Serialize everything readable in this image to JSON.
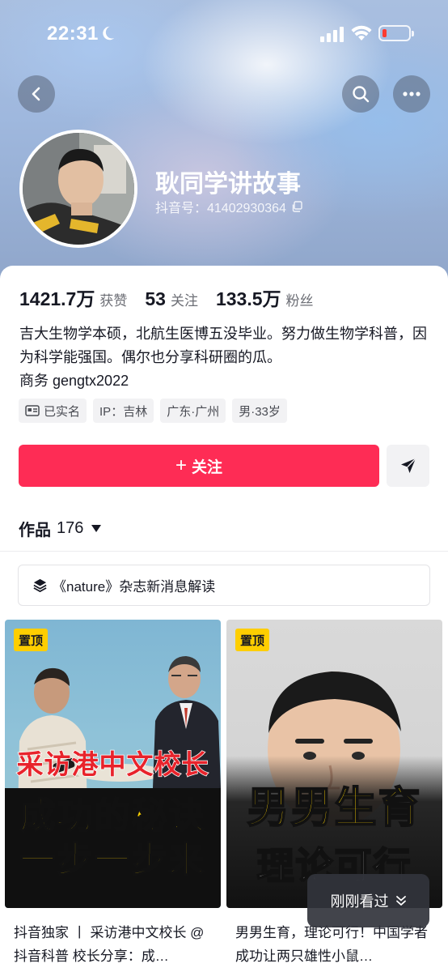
{
  "status_bar": {
    "time": "22:31"
  },
  "profile": {
    "nickname": "耿同学讲故事",
    "douyin_id": "抖音号：41402930364",
    "stats": [
      {
        "value": "1421.7万",
        "label": "获赞"
      },
      {
        "value": "53",
        "label": "关注"
      },
      {
        "value": "133.5万",
        "label": "粉丝"
      }
    ],
    "bio": "吉大生物学本硕，北航生医博五没毕业。努力做生物学科普，因为科学能强国。偶尔也分享科研圈的瓜。",
    "business": "商务 gengtx2022",
    "tags": [
      "已实名",
      "IP：吉林",
      "广东·广州",
      "男·33岁"
    ]
  },
  "actions": {
    "follow_label": "关注",
    "follow_plus": "+"
  },
  "works": {
    "label": "作品",
    "count": "176"
  },
  "collection": {
    "label": "《nature》杂志新消息解读"
  },
  "videos": [
    {
      "pin": "置顶",
      "overlay_top": "采访港中文校长",
      "overlay_line1": "成功的秘诀",
      "overlay_line2": "一步一步来",
      "title": "抖音独家 丨 采访港中文校长 @抖音科普 校长分享：成…"
    },
    {
      "pin": "置顶",
      "overlay_line1": "男男生育",
      "overlay_line2": "理论可行",
      "title": "男男生育，理论可行！中国学者成功让两只雄性小鼠…"
    }
  ],
  "recent_chip": {
    "label": "刚刚看过"
  },
  "colors": {
    "accent": "#fe2c55",
    "pin": "#fece00"
  }
}
